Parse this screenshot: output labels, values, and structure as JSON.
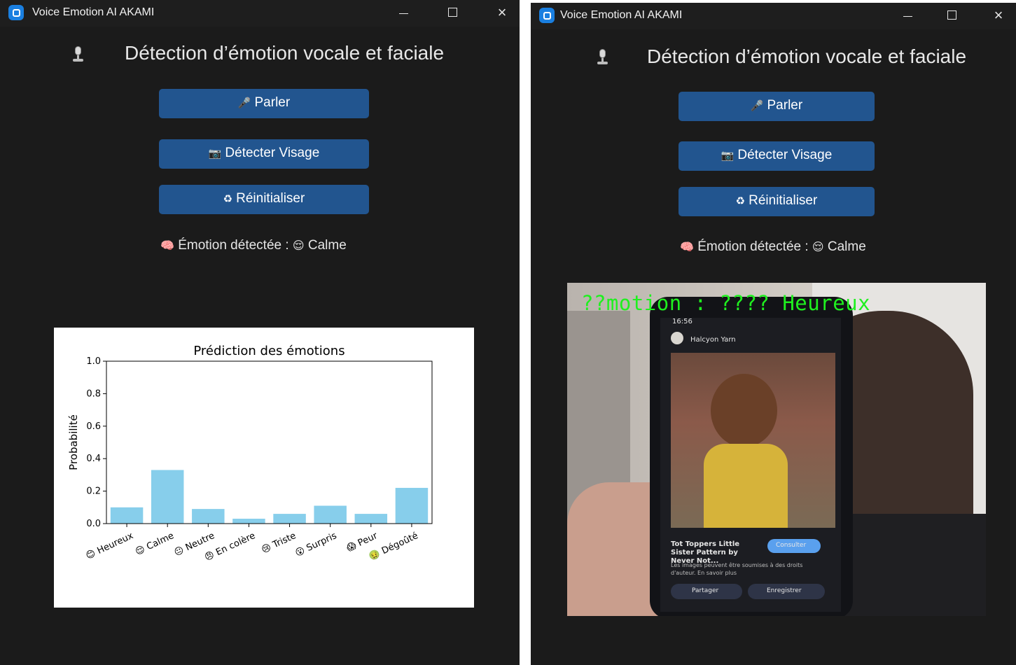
{
  "left_window": {
    "title": "Voice Emotion AI AKAMI",
    "heading": "Détection d’émotion vocale et faciale",
    "buttons": {
      "speak_icon": "🎤",
      "speak_label": "Parler",
      "detect_face_icon": "📷",
      "detect_face_label": "Détecter Visage",
      "reset_icon": "♻",
      "reset_label": "Réinitialiser"
    },
    "result": {
      "icon": "🧠",
      "label": "Émotion détectée :",
      "emoji": "😌",
      "value": "Calme"
    }
  },
  "right_window": {
    "title": "Voice Emotion AI AKAMI",
    "heading": "Détection d’émotion vocale et faciale",
    "buttons": {
      "speak_icon": "🎤",
      "speak_label": "Parler",
      "detect_face_icon": "📷",
      "detect_face_label": "Détecter Visage",
      "reset_icon": "♻",
      "reset_label": "Réinitialiser"
    },
    "result": {
      "icon": "🧠",
      "label": "Émotion détectée :",
      "emoji": "😌",
      "value": "Calme"
    },
    "camera": {
      "overlay_text": "??motion : ???? Heureux",
      "phone_time": "16:56",
      "phone_app_name": "Halcyon Yarn",
      "phone_caption": "Tot Toppers Little Sister Pattern by Never Not...",
      "phone_consult_button": "Consulter",
      "phone_disclaimer": "Les images peuvent être soumises à des droits d'auteur. En savoir plus",
      "phone_share_button": "Partager",
      "phone_save_button": "Enregistrer"
    }
  },
  "chart_data": {
    "type": "bar",
    "title": "Prédiction des émotions",
    "xlabel": "",
    "ylabel": "Probabilité",
    "ylim": [
      0,
      1.0
    ],
    "yticks": [
      "0.0",
      "0.2",
      "0.4",
      "0.6",
      "0.8",
      "1.0"
    ],
    "categories": [
      "😊 Heureux",
      "😌 Calme",
      "😐 Neutre",
      "😠 En colère",
      "😢 Triste",
      "😮 Surpris",
      "😱 Peur",
      "🤢 Dégoûté"
    ],
    "values": [
      0.1,
      0.33,
      0.09,
      0.03,
      0.06,
      0.11,
      0.06,
      0.22
    ],
    "bar_color": "#87ceeb",
    "grid": false
  },
  "colors": {
    "window_bg": "#1b1b1b",
    "button_bg": "#22558f",
    "overlay_text": "#1ff01f"
  }
}
